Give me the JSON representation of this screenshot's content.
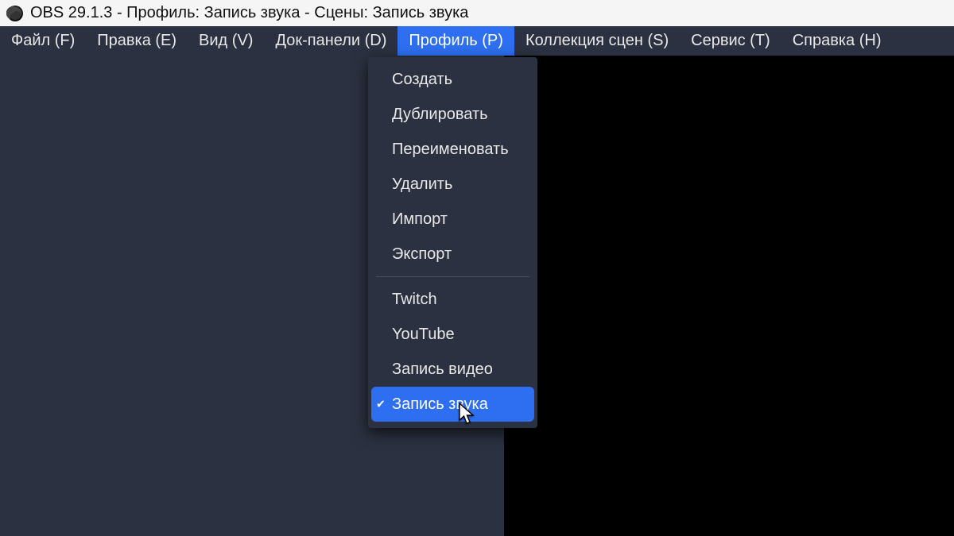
{
  "title": "OBS 29.1.3 - Профиль: Запись звука - Сцены: Запись звука",
  "menu": {
    "file": "Файл (F)",
    "edit": "Правка (E)",
    "view": "Вид (V)",
    "docks": "Док-панели (D)",
    "profile": "Профиль (P)",
    "scenes": "Коллекция сцен (S)",
    "tools": "Сервис (T)",
    "help": "Справка (H)"
  },
  "dropdown": {
    "new": "Создать",
    "duplicate": "Дублировать",
    "rename": "Переименовать",
    "delete": "Удалить",
    "import": "Импорт",
    "export": "Экспорт",
    "p_twitch": "Twitch",
    "p_youtube": "YouTube",
    "p_video": "Запись видео",
    "p_audio": "Запись звука"
  }
}
